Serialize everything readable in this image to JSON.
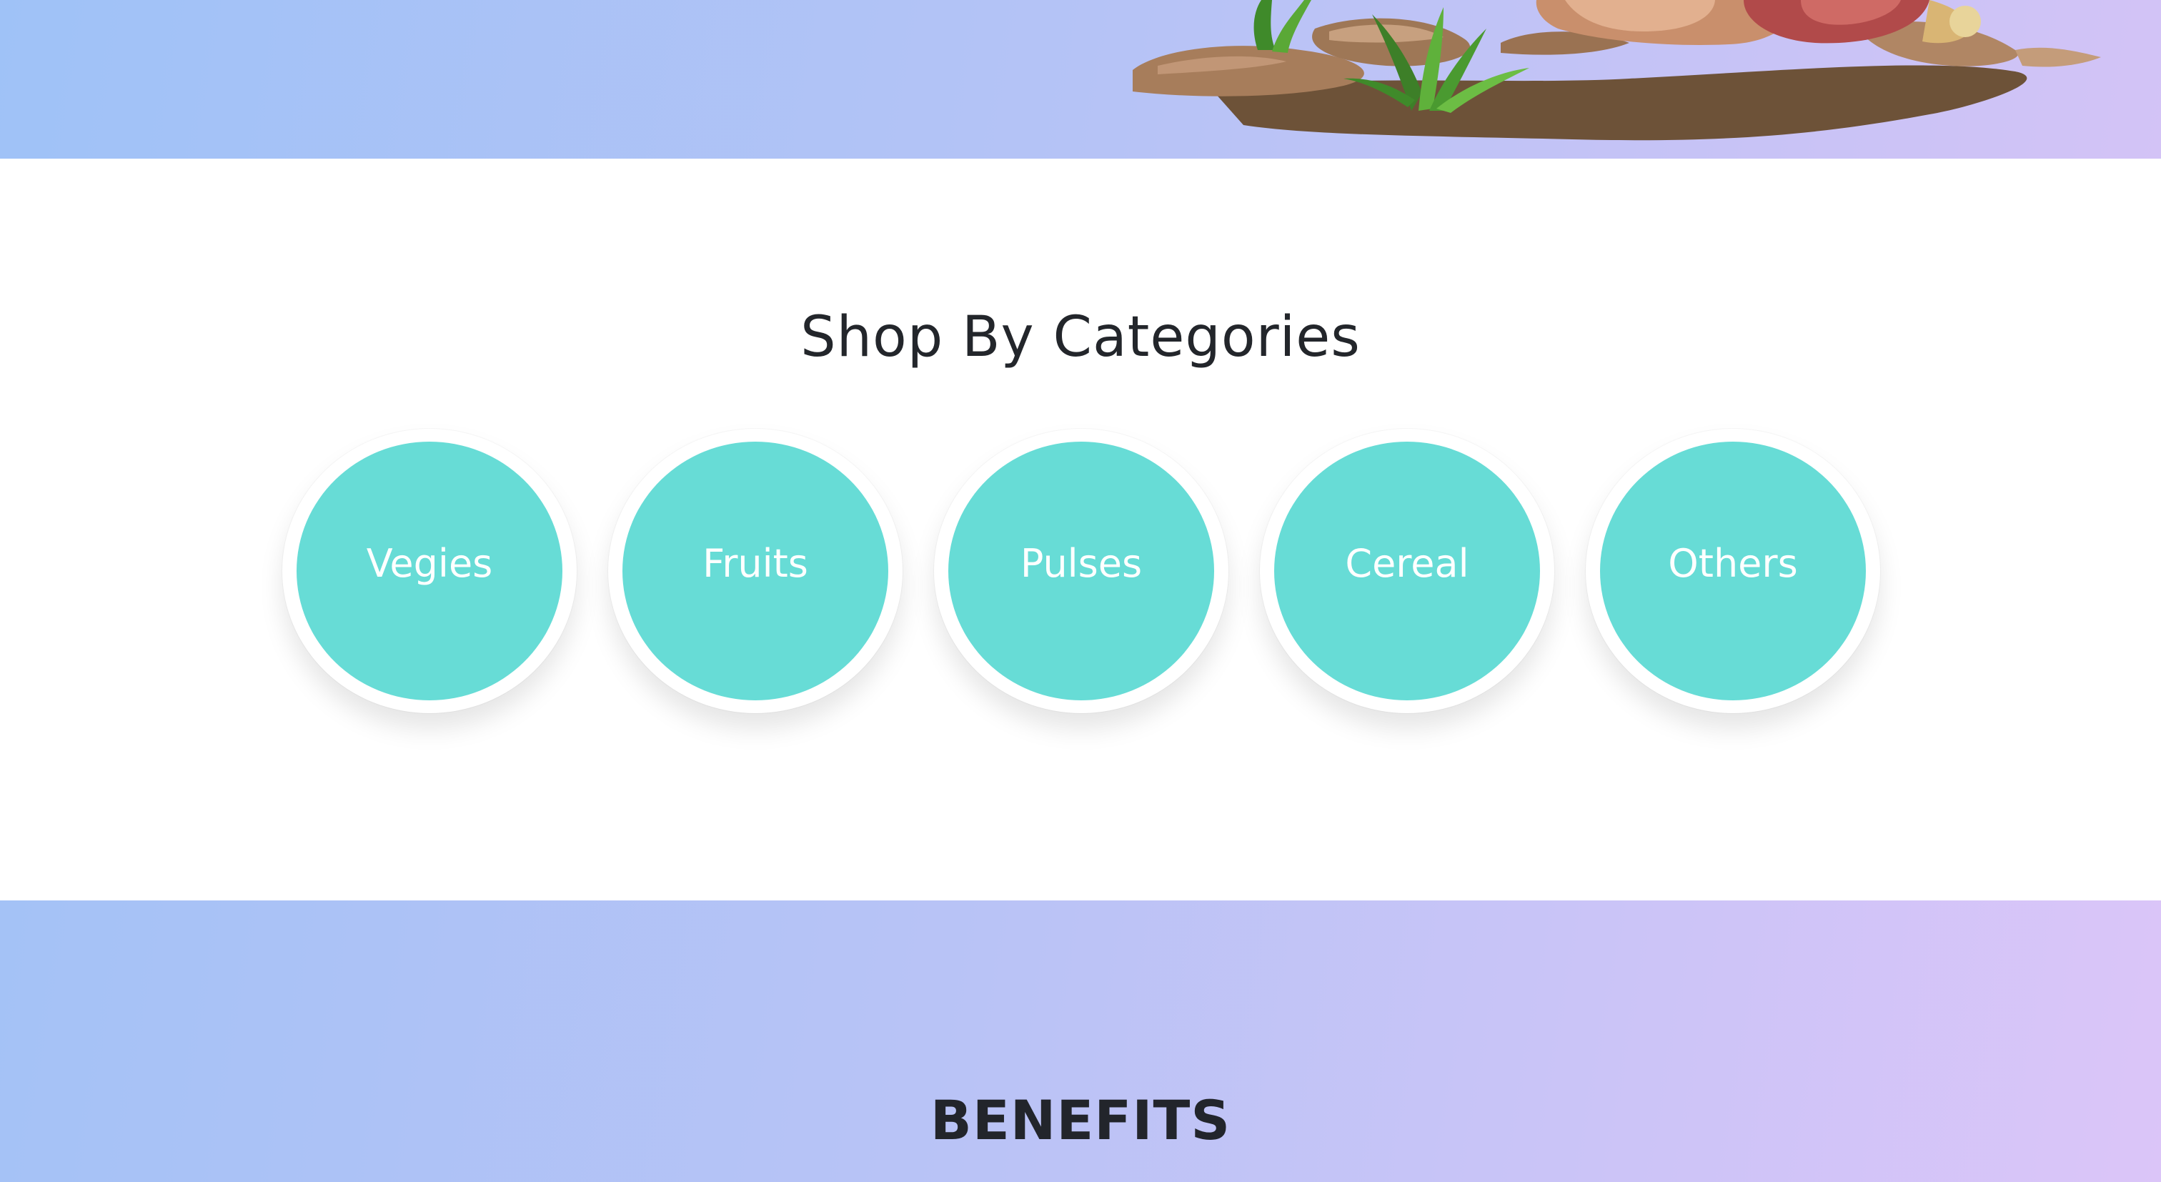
{
  "categories_section": {
    "title": "Shop By Categories",
    "items": [
      {
        "label": "Vegies"
      },
      {
        "label": "Fruits"
      },
      {
        "label": "Pulses"
      },
      {
        "label": "Cereal"
      },
      {
        "label": "Others"
      }
    ]
  },
  "benefits_section": {
    "title": "BENEFITS"
  },
  "colors": {
    "category_fill": "#67dcd6",
    "band_gradient_start": "#9fc2f7",
    "band_gradient_end": "#d3c3f6",
    "title_text": "#23262b"
  }
}
